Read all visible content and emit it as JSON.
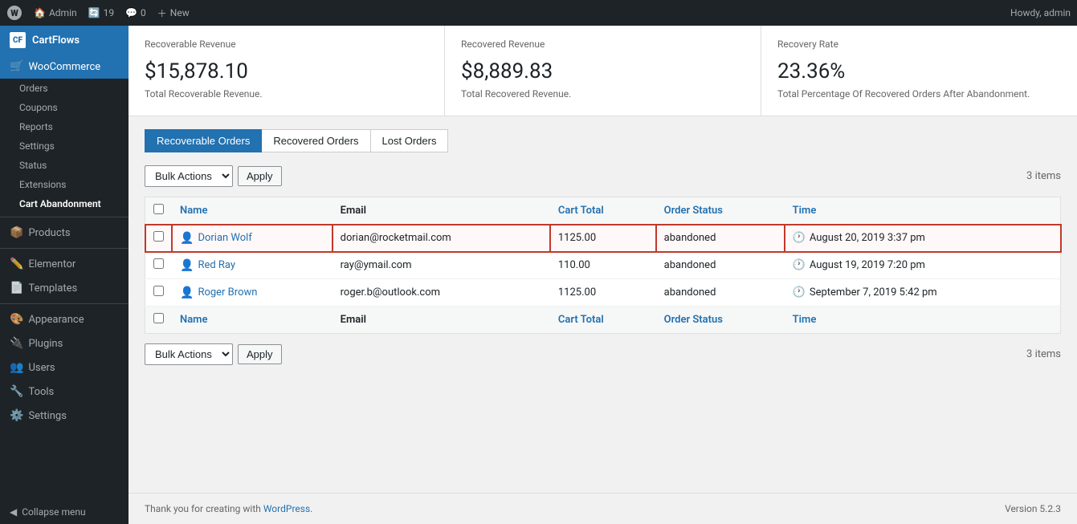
{
  "topbar": {
    "wp_label": "Admin",
    "updates_count": "19",
    "comments_count": "0",
    "new_label": "New",
    "howdy": "Howdy, admin"
  },
  "sidebar": {
    "brand": "CartFlows",
    "brand_icon": "CF",
    "woocommerce_label": "WooCommerce",
    "items": [
      {
        "id": "orders",
        "label": "Orders"
      },
      {
        "id": "coupons",
        "label": "Coupons"
      },
      {
        "id": "reports",
        "label": "Reports"
      },
      {
        "id": "settings",
        "label": "Settings"
      },
      {
        "id": "status",
        "label": "Status"
      },
      {
        "id": "extensions",
        "label": "Extensions"
      }
    ],
    "cart_abandonment_label": "Cart Abandonment",
    "products_label": "Products",
    "elementor_label": "Elementor",
    "templates_label": "Templates",
    "appearance_label": "Appearance",
    "plugins_label": "Plugins",
    "users_label": "Users",
    "tools_label": "Tools",
    "settings_label": "Settings",
    "collapse_label": "Collapse menu"
  },
  "stats": [
    {
      "label": "Recoverable Revenue",
      "value": "$15,878.10",
      "desc": "Total Recoverable Revenue."
    },
    {
      "label": "Recovered Revenue",
      "value": "$8,889.83",
      "desc": "Total Recovered Revenue."
    },
    {
      "label": "Recovery Rate",
      "value": "23.36%",
      "desc": "Total Percentage Of Recovered Orders After Abandonment."
    }
  ],
  "tabs": [
    {
      "id": "recoverable",
      "label": "Recoverable Orders",
      "active": true
    },
    {
      "id": "recovered",
      "label": "Recovered Orders",
      "active": false
    },
    {
      "id": "lost",
      "label": "Lost Orders",
      "active": false
    }
  ],
  "bulk_actions": {
    "label": "Bulk Actions",
    "apply_label": "Apply"
  },
  "table": {
    "items_count": "3 items",
    "columns": [
      {
        "id": "name",
        "label": "Name",
        "color": "blue"
      },
      {
        "id": "email",
        "label": "Email",
        "color": "plain"
      },
      {
        "id": "cart_total",
        "label": "Cart Total",
        "color": "blue"
      },
      {
        "id": "order_status",
        "label": "Order Status",
        "color": "blue"
      },
      {
        "id": "time",
        "label": "Time",
        "color": "blue"
      }
    ],
    "rows": [
      {
        "id": "row1",
        "highlighted": true,
        "name": "Dorian Wolf",
        "email": "dorian@rocketmail.com",
        "cart_total": "1125.00",
        "order_status": "abandoned",
        "time": "August 20, 2019 3:37 pm"
      },
      {
        "id": "row2",
        "highlighted": false,
        "name": "Red Ray",
        "email": "ray@ymail.com",
        "cart_total": "110.00",
        "order_status": "abandoned",
        "time": "August 19, 2019 7:20 pm"
      },
      {
        "id": "row3",
        "highlighted": false,
        "name": "Roger Brown",
        "email": "roger.b@outlook.com",
        "cart_total": "1125.00",
        "order_status": "abandoned",
        "time": "September 7, 2019 5:42 pm"
      }
    ]
  },
  "footer": {
    "credit_text": "Thank you for creating with",
    "wp_link_label": "WordPress",
    "version": "Version 5.2.3"
  }
}
